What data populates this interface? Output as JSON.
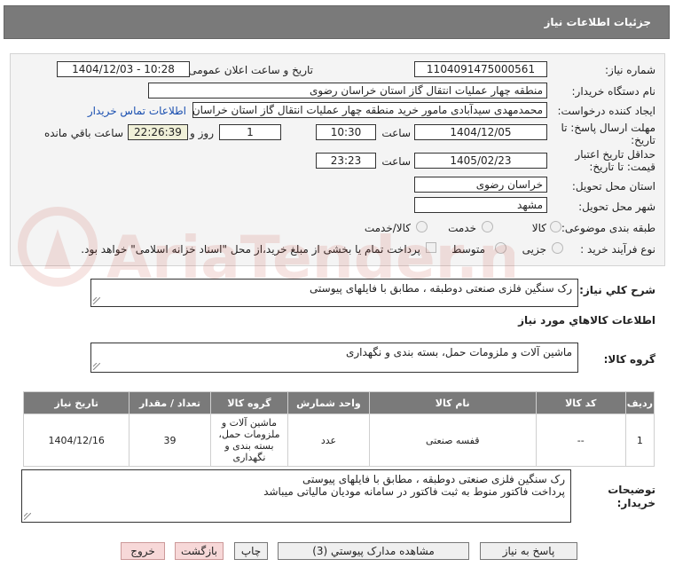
{
  "header": {
    "title": "جزئیات اطلاعات نیاز"
  },
  "form": {
    "need_number_label": "شماره نیاز:",
    "need_number": "1104091475000561",
    "announce_label": "تاریخ و ساعت اعلان عمومی:",
    "announce_value": "1404/12/03 - 10:28",
    "buyer_org_label": "نام دستگاه خریدار:",
    "buyer_org": "منطقه چهار عملیات انتقال گاز   استان خراسان رضوی",
    "creator_label": "ایجاد کننده درخواست:",
    "creator": "محمدمهدی سیدآبادی مامور خرید منطقه چهار عملیات انتقال گاز   استان خراسان رضوی",
    "contact_link": "اطلاعات تماس خریدار",
    "deadline_label_1": "مهلت ارسال پاسخ: تا",
    "deadline_label_2": "تاریخ:",
    "deadline_date": "1404/12/05",
    "time_label": "ساعت",
    "deadline_time": "10:30",
    "days_value": "1",
    "days_label": "روز و",
    "remaining_time": "22:26:39",
    "remaining_label": "ساعت باقي مانده",
    "validity_label_1": "حداقل تاریخ اعتبار",
    "validity_label_2": "قیمت: تا تاریخ:",
    "validity_date": "1405/02/23",
    "validity_time": "23:23",
    "province_label": "استان محل تحویل:",
    "province": "خراسان رضوی",
    "city_label": "شهر محل تحویل:",
    "city": "مشهد",
    "category_label": "طبقه بندی موضوعی:",
    "category_options": [
      "کالا",
      "خدمت",
      "کالا/خدمت"
    ],
    "process_label": "نوع فرآیند خرید :",
    "process_options": [
      "جزیی",
      "متوسط"
    ],
    "payment_note": "پرداخت تمام یا بخشی از مبلغ خرید،از محل \"اسناد خزانه اسلامی\" خواهد بود."
  },
  "summary": {
    "label": "شرح کلي نياز:",
    "text": "رک سنگین فلزی صنعتی دوطبقه ، مطابق با فایلهای پیوستی"
  },
  "goods_section_title": "اطلاعات کالاهاي مورد نياز",
  "goods_group": {
    "label": "گروه کالا:",
    "value": "ماشین آلات و ملزومات حمل، بسته بندی و نگهداری"
  },
  "table": {
    "headers": [
      "ردیف",
      "کد کالا",
      "نام کالا",
      "واحد شمارش",
      "گروه کالا",
      "تعداد / مقدار",
      "تاریخ نیاز"
    ],
    "rows": [
      [
        "1",
        "--",
        "قفسه صنعتی",
        "عدد",
        "ماشین آلات و ملزومات حمل، بسته بندی و نگهداری",
        "39",
        "1404/12/16"
      ]
    ]
  },
  "buyer_notes": {
    "label_1": "توضیحات",
    "label_2": "خریدار:",
    "line1": "رک سنگین فلزی صنعتی دوطبقه ، مطابق با فایلهای پیوستی",
    "line2": "پرداخت فاکتور منوط به ثبت فاکتور در سامانه مودیان مالیاتی میباشد"
  },
  "buttons": {
    "reply": "پاسخ به نیاز",
    "attachments": "مشاهده مدارک پیوستي (3)",
    "print": "چاپ",
    "back": "بازگشت",
    "exit": "خروج"
  },
  "watermark": {
    "text": "AriaTender.net"
  }
}
